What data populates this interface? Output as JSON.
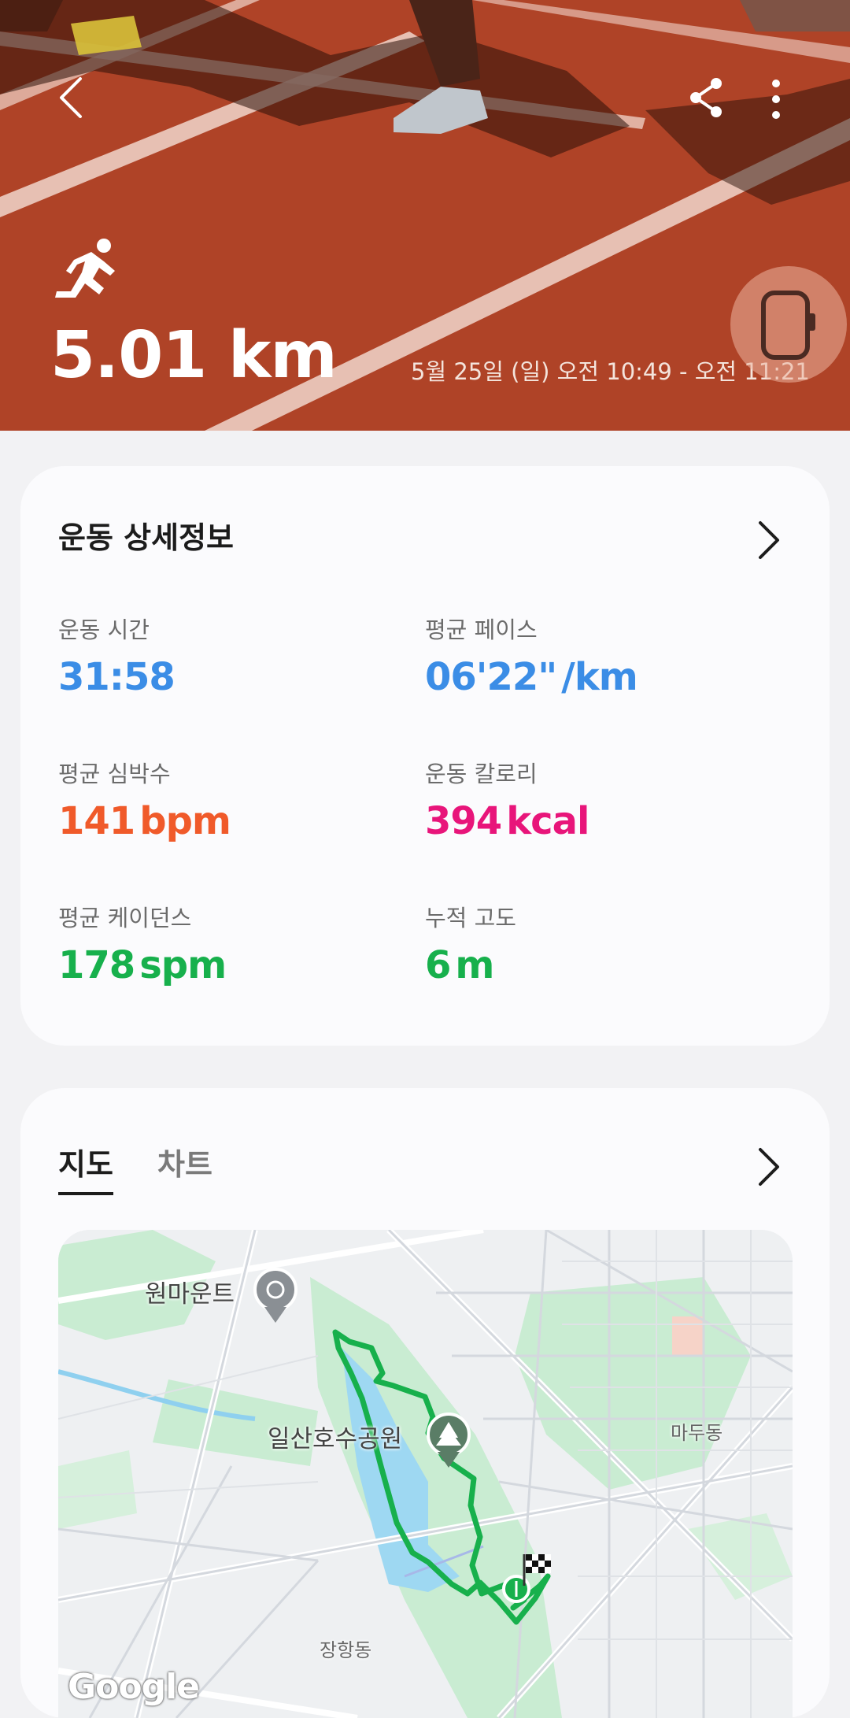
{
  "hero": {
    "distance": "5.01 km",
    "datetime": "5월 25일 (일) 오전 10:49 - 오전 11:21"
  },
  "details": {
    "title": "운동 상세정보",
    "stats": [
      {
        "label": "운동 시간",
        "value": "31:58",
        "unit": "",
        "color": "#3b8de6"
      },
      {
        "label": "평균 페이스",
        "value": "06'22\"",
        "unit": "/km",
        "color": "#3b8de6"
      },
      {
        "label": "평균 심박수",
        "value": "141",
        "unit": "bpm",
        "color": "#f05a2a"
      },
      {
        "label": "운동 칼로리",
        "value": "394",
        "unit": "kcal",
        "color": "#e8157a"
      },
      {
        "label": "평균 케이던스",
        "value": "178",
        "unit": "spm",
        "color": "#17b04c"
      },
      {
        "label": "누적 고도",
        "value": "6",
        "unit": "m",
        "color": "#17b04c"
      }
    ]
  },
  "map_card": {
    "tabs": [
      "지도",
      "차트"
    ],
    "active_tab": "지도",
    "map_labels": {
      "one_mount": "원마운트",
      "lake_park": "일산호수공원",
      "madu": "마두동",
      "janghang": "장항동"
    },
    "attribution": "Google"
  },
  "icons": {
    "back": "back-arrow-icon",
    "share": "share-icon",
    "more": "more-vertical-icon",
    "activity": "running-icon",
    "device": "watch-icon",
    "chevron": "chevron-right-icon"
  },
  "colors": {
    "hero_track": "#b6482a",
    "route": "#17b04c",
    "pace_blue": "#3b8de6",
    "heart_orange": "#f05a2a",
    "calorie_pink": "#e8157a",
    "cadence_green": "#17b04c"
  }
}
